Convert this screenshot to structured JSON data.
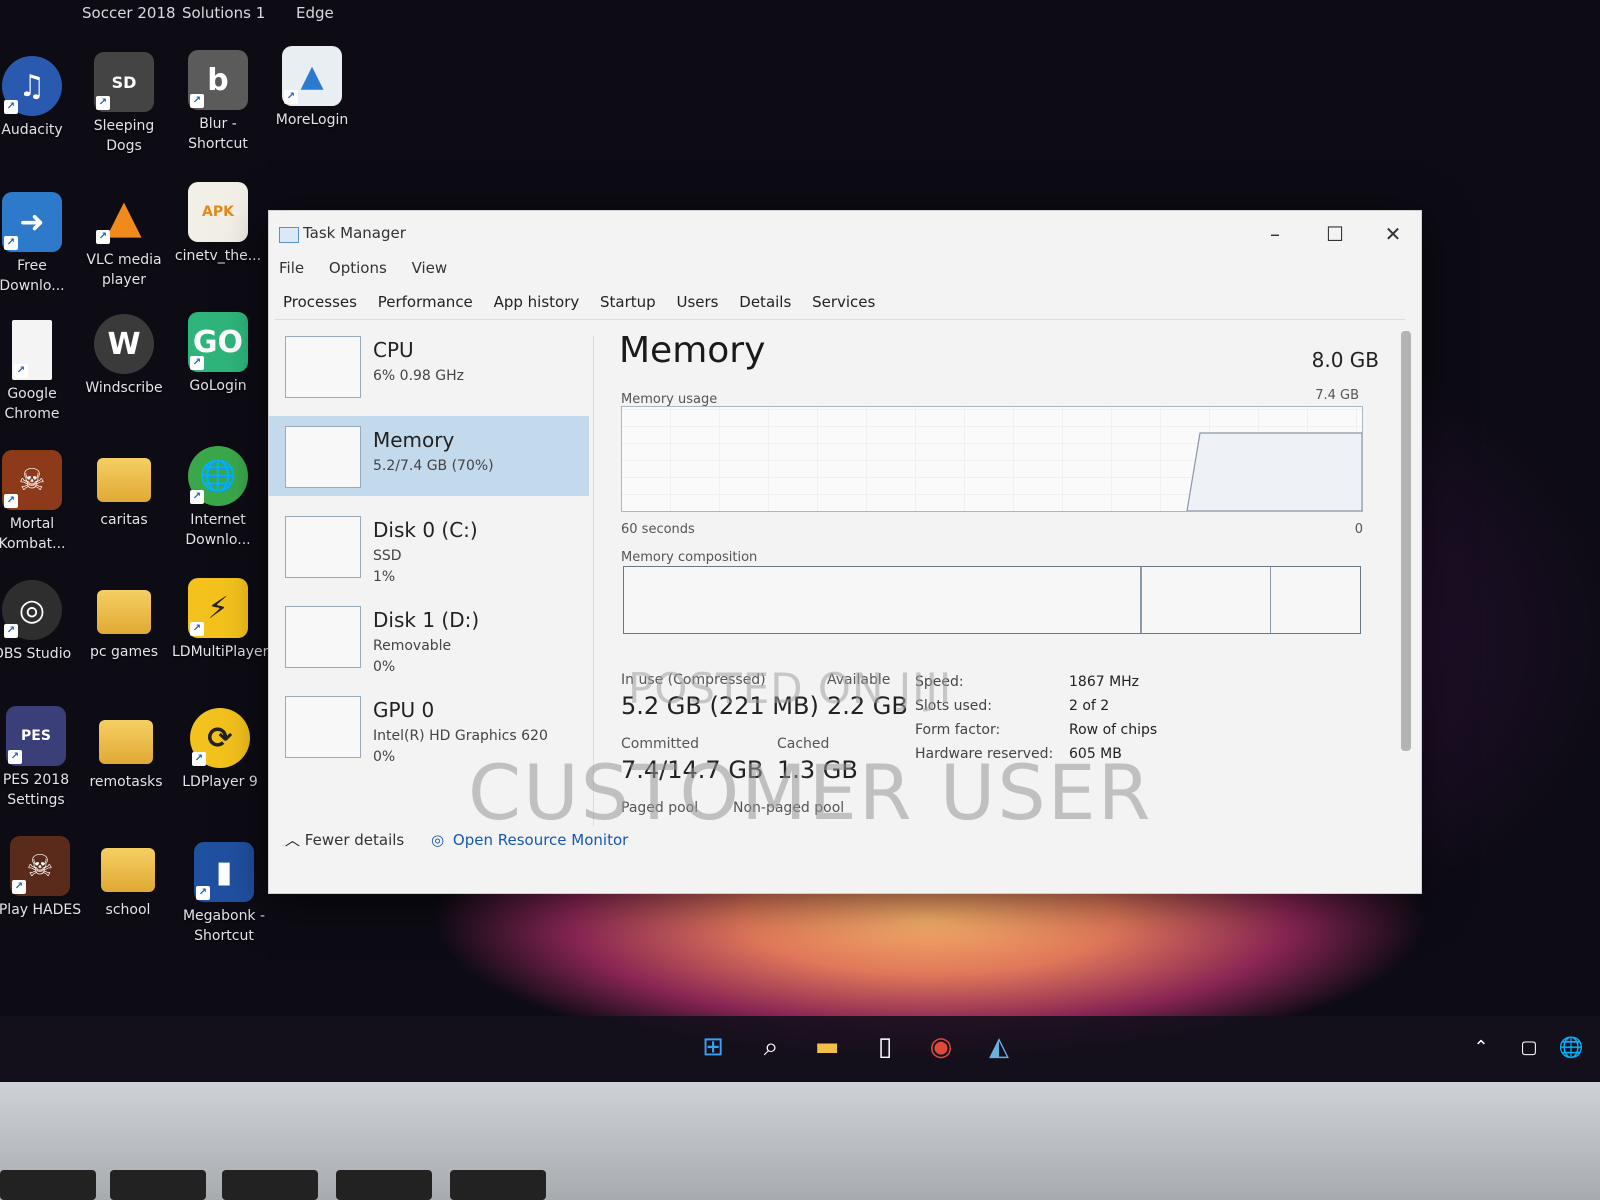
{
  "desktop": {
    "top_labels": [
      "Soccer 2018",
      "Solutions 1",
      "Edge"
    ],
    "icons": [
      {
        "label": "Audacity",
        "icon": "audacity-icon",
        "color": "#2a5ab0"
      },
      {
        "label": "Sleeping Dogs",
        "icon": "sleeping-dogs-icon",
        "color": "#444444"
      },
      {
        "label": "Blur - Shortcut",
        "icon": "blur-icon",
        "color": "#5b5b5b"
      },
      {
        "label": "MoreLogin",
        "icon": "morelogin-icon",
        "color": "#e9eef3"
      },
      {
        "label": "Free Downlo...",
        "icon": "free-download-icon",
        "color": "#2c7ac9"
      },
      {
        "label": "VLC media player",
        "icon": "vlc-icon",
        "color": "#f18a1c"
      },
      {
        "label": "cinetv_the...",
        "icon": "apk-icon",
        "color": "#f2efe6"
      },
      {
        "label": "Google Chrome",
        "icon": "file-icon",
        "color": "#f4f4f4"
      },
      {
        "label": "Windscribe",
        "icon": "windscribe-icon",
        "color": "#3a3a3a"
      },
      {
        "label": "GoLogin",
        "icon": "gologin-icon",
        "color": "#2fb57c"
      },
      {
        "label": "Mortal Kombat...",
        "icon": "mortal-kombat-icon",
        "color": "#8c3a1a"
      },
      {
        "label": "caritas",
        "icon": "folder-icon",
        "color": "#f0c04a"
      },
      {
        "label": "Internet Downlo...",
        "icon": "internet-download-icon",
        "color": "#3aa84a"
      },
      {
        "label": "OBS Studio",
        "icon": "obs-icon",
        "color": "#2e2e2e"
      },
      {
        "label": "pc games",
        "icon": "folder-icon",
        "color": "#f0c04a"
      },
      {
        "label": "LDMultiPlayer",
        "icon": "ldmultiplayer-icon",
        "color": "#f4c21c"
      },
      {
        "label": "PES 2018 Settings",
        "icon": "pes-icon",
        "color": "#3a3f7a"
      },
      {
        "label": "remotasks",
        "icon": "folder-icon",
        "color": "#f0c04a"
      },
      {
        "label": "LDPlayer 9",
        "icon": "ldplayer-icon",
        "color": "#f4c21c"
      },
      {
        "label": "Play HADES",
        "icon": "hades-icon",
        "color": "#5a2a1a"
      },
      {
        "label": "school",
        "icon": "folder-icon",
        "color": "#f0c04a"
      },
      {
        "label": "Megabonk - Shortcut",
        "icon": "megabonk-icon",
        "color": "#2050a0"
      }
    ]
  },
  "taskmanager": {
    "title": "Task Manager",
    "menu": [
      "File",
      "Options",
      "View"
    ],
    "tabs": [
      "Processes",
      "Performance",
      "App history",
      "Startup",
      "Users",
      "Details",
      "Services"
    ],
    "sidebar": [
      {
        "title": "CPU",
        "sub": "6% 0.98 GHz"
      },
      {
        "title": "Memory",
        "sub": "5.2/7.4 GB (70%)"
      },
      {
        "title": "Disk 0 (C:)",
        "sub": "SSD\n1%"
      },
      {
        "title": "Disk 1 (D:)",
        "sub": "Removable\n0%"
      },
      {
        "title": "GPU 0",
        "sub": "Intel(R) HD Graphics 620\n0%"
      }
    ],
    "main": {
      "title": "Memory",
      "total": "8.0 GB",
      "usage_label": "Memory usage",
      "usage_max": "7.4 GB",
      "time_label": "60 seconds",
      "time_end": "0",
      "composition_label": "Memory composition",
      "in_use_label": "In use (Compressed)",
      "in_use_value": "5.2 GB (221 MB)",
      "available_label": "Available",
      "available_value": "2.2 GB",
      "committed_label": "Committed",
      "committed_value": "7.4/14.7 GB",
      "cached_label": "Cached",
      "cached_value": "1.3 GB",
      "paged_label": "Paged pool",
      "nonpaged_label": "Non-paged pool",
      "speed_label": "Speed:",
      "speed_value": "1867 MHz",
      "slots_label": "Slots used:",
      "slots_value": "2 of 2",
      "form_label": "Form factor:",
      "form_value": "Row of chips",
      "hw_label": "Hardware reserved:",
      "hw_value": "605 MB"
    },
    "footer": {
      "fewer": "Fewer details",
      "monitor": "Open Resource Monitor"
    }
  },
  "watermark": {
    "line1": "POSTED ON JIJI",
    "line2": "CUSTOMER USER"
  },
  "taskbar": [
    "windows-start-icon",
    "search-icon",
    "file-explorer-icon",
    "notes-icon",
    "chrome-icon",
    "task-manager-icon"
  ]
}
